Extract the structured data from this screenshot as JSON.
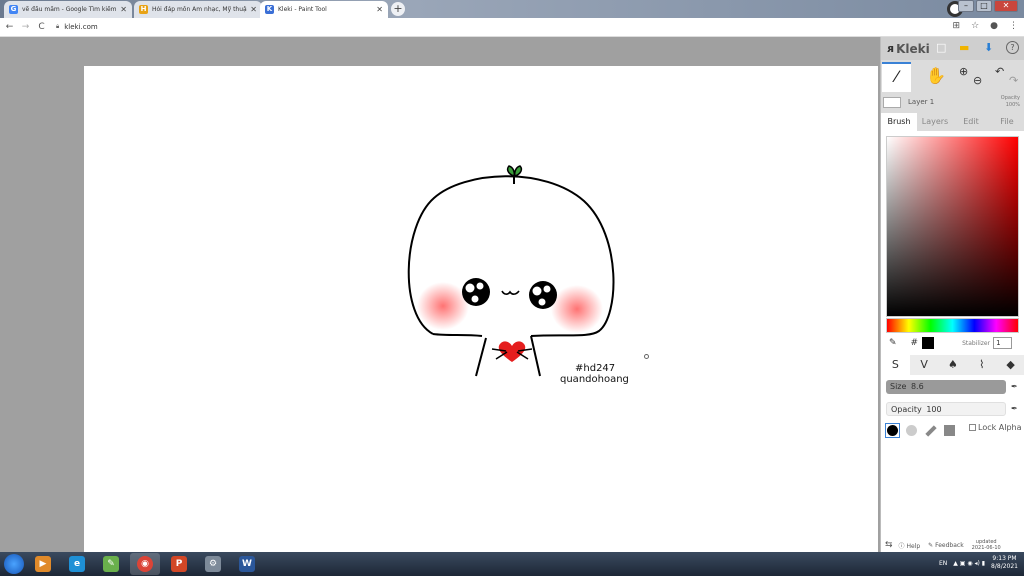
{
  "browser": {
    "tabs": [
      {
        "title": "vẽ đầu mầm - Google Tìm kiếm",
        "favicon": "G",
        "color": "#4285f4",
        "active": false
      },
      {
        "title": "Hỏi đáp môn Âm nhạc, Mỹ thuật",
        "favicon": "H",
        "color": "#e8a317",
        "active": false
      },
      {
        "title": "Kleki - Paint Tool",
        "favicon": "K",
        "color": "#3b6fd6",
        "active": true
      }
    ],
    "new_tab": "+",
    "window_controls": {
      "minimize": "–",
      "maximize": "□",
      "close": "✕"
    },
    "nav": {
      "back": "←",
      "forward": "→",
      "reload": "C"
    },
    "url": "kleki.com",
    "addr_icons": {
      "translate": "⊞",
      "bookmark": "☆",
      "account": "●",
      "menu": "⋮"
    }
  },
  "canvas": {
    "signature_line1": "#hd247",
    "signature_line2": "quandohoang",
    "colors": {
      "outline": "#000000",
      "blush": "#ff5a5a",
      "heart": "#e51e1e",
      "sprout": "#3a9d3a"
    }
  },
  "panel": {
    "logo": "Kleki",
    "top_icons": {
      "new": "□",
      "folder": "▬",
      "download": "⬇",
      "help": "?"
    },
    "tools": {
      "brush": "⁄",
      "hand": "✋",
      "zoom_in": "⊕",
      "zoom_out": "⊖",
      "undo": "↶",
      "redo": "↷"
    },
    "layer": {
      "name": "Layer 1",
      "opacity_label": "Opacity",
      "opacity_value": "100%"
    },
    "tabs": [
      "Brush",
      "Layers",
      "Edit",
      "File"
    ],
    "active_tab": "Brush",
    "color": {
      "hash": "#",
      "current": "#000000",
      "stabilizer_label": "Stabilizer",
      "stabilizer_value": "1"
    },
    "brush_types": [
      "S",
      "V",
      "♠",
      "⌇",
      "◆"
    ],
    "size": {
      "label": "Size",
      "value": "8.6"
    },
    "opacity": {
      "label": "Opacity",
      "value": "100"
    },
    "lock_alpha": "Lock Alpha",
    "footer": {
      "help": "Help",
      "feedback": "Feedback",
      "updated_line1": "updated",
      "updated_line2": "2021-06-10"
    }
  },
  "taskbar": {
    "apps": [
      {
        "name": "media",
        "label": "▶",
        "color": "#e08a2a"
      },
      {
        "name": "ie",
        "label": "e",
        "color": "#1e90d6"
      },
      {
        "name": "paint",
        "label": "✎",
        "color": "#6ab04c"
      },
      {
        "name": "chrome",
        "label": "◉",
        "color": "#db4437",
        "active": true
      },
      {
        "name": "powerpoint",
        "label": "P",
        "color": "#d24726"
      },
      {
        "name": "tools",
        "label": "⚙",
        "color": "#7d8a99"
      },
      {
        "name": "word",
        "label": "W",
        "color": "#2b579a"
      }
    ],
    "lang": "EN",
    "time": "9:13 PM",
    "date": "8/8/2021"
  }
}
